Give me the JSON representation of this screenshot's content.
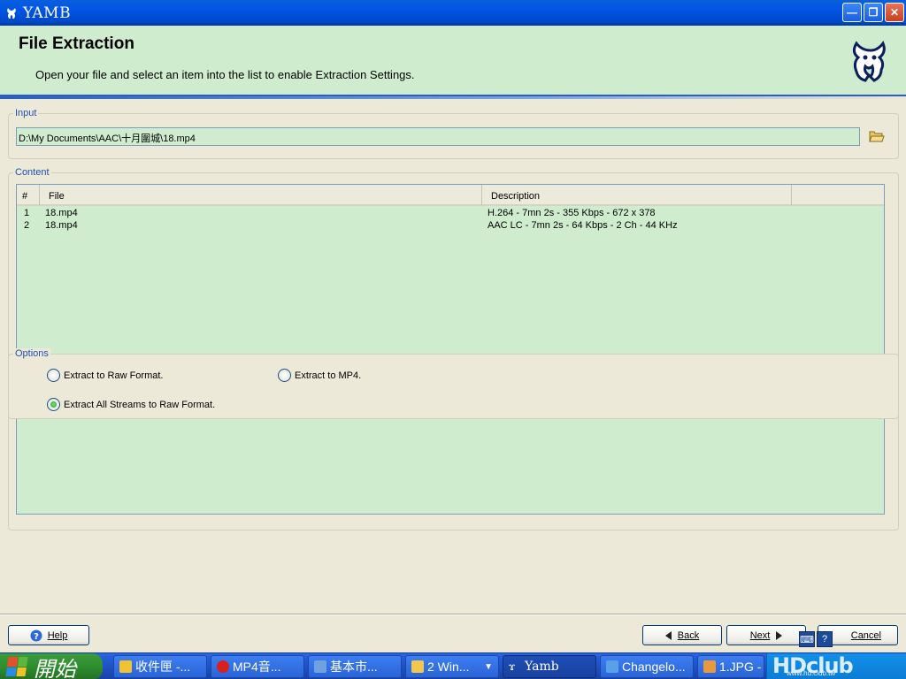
{
  "window": {
    "title": "YAMB"
  },
  "header": {
    "title": "File Extraction",
    "subtitle": "Open your file and select an item into the list to enable Extraction Settings."
  },
  "input_group": {
    "label": "Input",
    "path_value": "D:\\My Documents\\AAC\\十月圍城\\18.mp4"
  },
  "content_group": {
    "label": "Content",
    "columns": [
      "#",
      "File",
      "Description"
    ],
    "rows": [
      {
        "num": "1",
        "file": "18.mp4",
        "description": "H.264 - 7mn 2s - 355 Kbps - 672 x 378"
      },
      {
        "num": "2",
        "file": "18.mp4",
        "description": "AAC LC - 7mn 2s - 64 Kbps - 2 Ch - 44 KHz"
      }
    ]
  },
  "options_group": {
    "label": "Options",
    "raw_label": "Extract to Raw Format.",
    "mp4_label": "Extract to MP4.",
    "all_streams_label": "Extract All Streams to Raw Format.",
    "selected": "all_streams"
  },
  "buttons": {
    "help": "Help",
    "back": "Back",
    "next": "Next",
    "cancel": "Cancel"
  },
  "taskbar": {
    "start_label": "開始",
    "tasks": [
      {
        "label": "收件匣 -...",
        "icon_color": "#f2c230"
      },
      {
        "label": "MP4音...",
        "icon_color": "#d8201c"
      },
      {
        "label": "基本市...",
        "icon_color": "#6fa0e0"
      },
      {
        "label": "2 Win...",
        "icon_color": "#f2c84a"
      },
      {
        "label": "Yamb",
        "icon_color": "#ffffff"
      },
      {
        "label": "Changelo...",
        "icon_color": "#5aa0e8"
      },
      {
        "label": "1.JPG -",
        "icon_color": "#e89a3a"
      }
    ],
    "tray_logo": "HDclub",
    "tray_url": "www.hd.club.tw"
  },
  "colors": {
    "header_bg": "#cfeccf",
    "accent_blue": "#2a5fbd",
    "group_label": "#1f4fb4"
  }
}
